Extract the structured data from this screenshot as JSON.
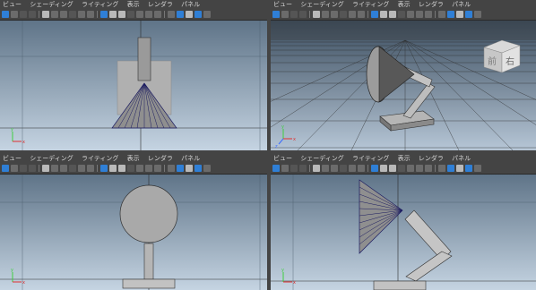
{
  "colors": {
    "ortho_bg_top": "#5f7488",
    "ortho_bg_bottom": "#c5d4e2",
    "persp_bg_top": "#3c4e60",
    "persp_bg_bottom": "#b6c6d6",
    "grid": "#3a3a3a",
    "mesh_fill": "#a7a7a7",
    "mesh_stroke": "#1a1a60",
    "toolbar_bg": "#444444",
    "menu_text": "#d8d8d8",
    "axis_x": "#e03030",
    "axis_y": "#3fcf3f",
    "axis_z": "#3c6cff",
    "selected_blue": "#2f7fd6"
  },
  "viewports": [
    {
      "name": "top-left",
      "menu": [
        "ビュー",
        "シェーディング",
        "ライティング",
        "表示",
        "レンダラ",
        "パネル"
      ],
      "camera": "front-ortho",
      "axes": [
        "y",
        "x"
      ]
    },
    {
      "name": "top-right",
      "menu": [
        "ビュー",
        "シェーディング",
        "ライティング",
        "表示",
        "レンダラ",
        "パネル"
      ],
      "camera": "perspective",
      "viewcube": {
        "front_label": "前",
        "right_label": "右"
      },
      "axes": [
        "y",
        "x",
        "z"
      ]
    },
    {
      "name": "bottom-left",
      "menu": [
        "ビュー",
        "シェーディング",
        "ライティング",
        "表示",
        "レンダラ",
        "パネル"
      ],
      "camera": "side-ortho",
      "axes": [
        "y",
        "x"
      ]
    },
    {
      "name": "bottom-right",
      "menu": [
        "ビュー",
        "シェーディング",
        "ライティング",
        "表示",
        "レンダラ",
        "パネル"
      ],
      "camera": "side-ortho-2",
      "axes": [
        "y",
        "x"
      ]
    }
  ]
}
